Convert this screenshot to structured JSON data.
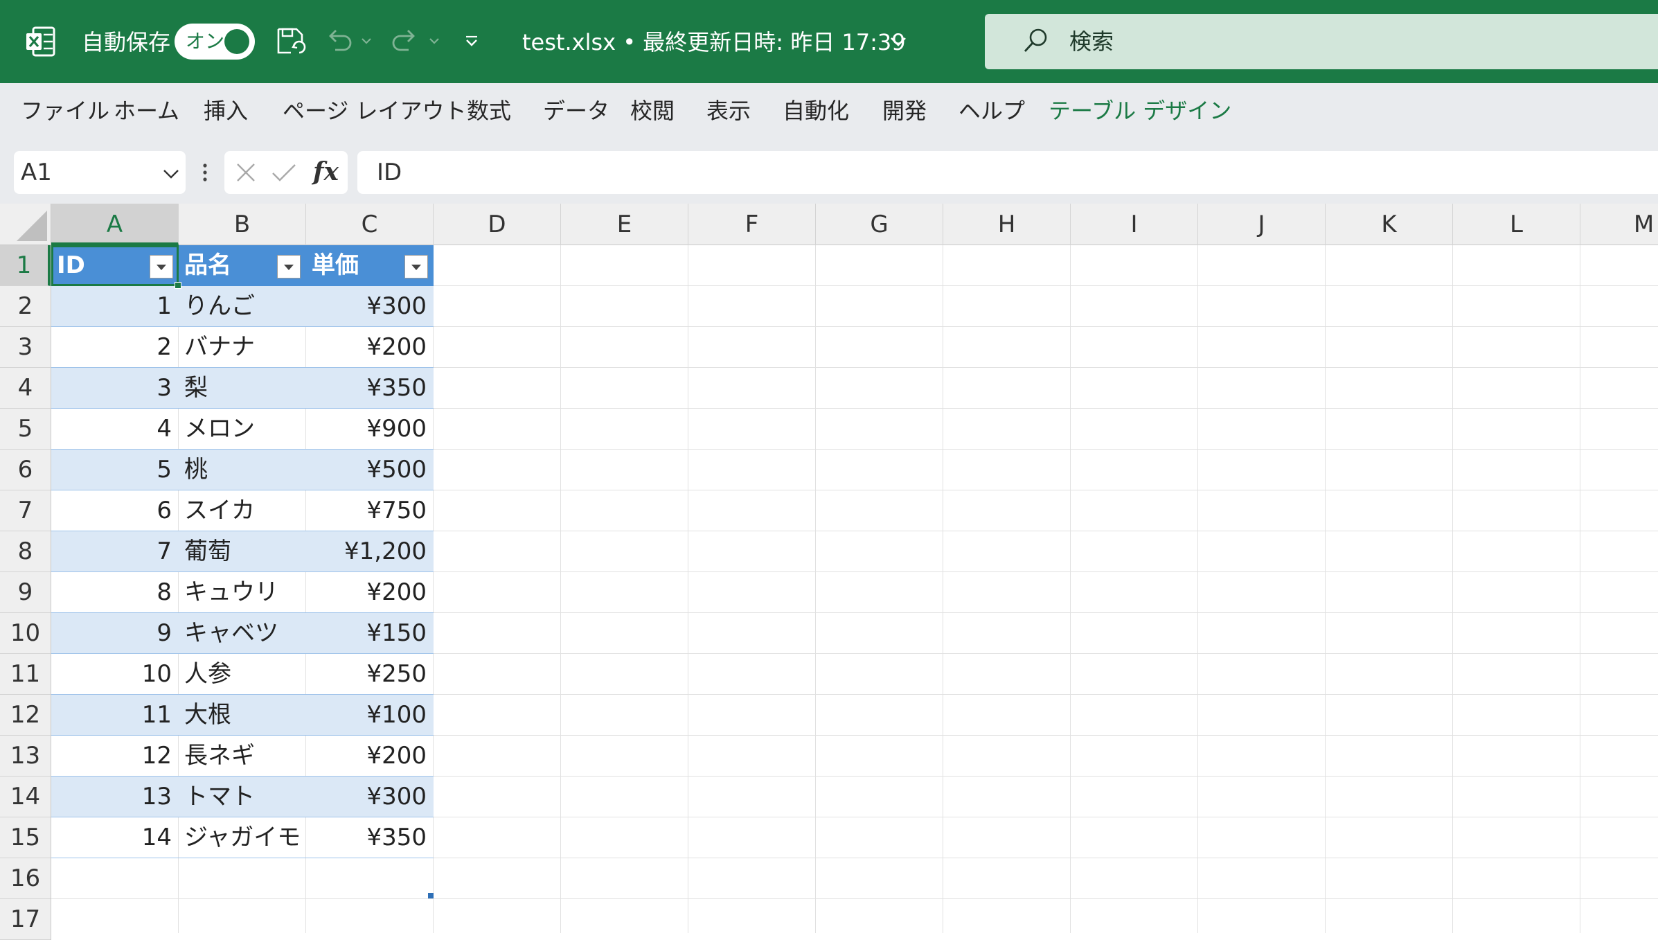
{
  "titlebar": {
    "app_icon": "excel-logo-icon",
    "autosave_label": "自動保存",
    "autosave_state": "オン",
    "doc_title": "test.xlsx • 最終更新日時: 昨日 17:39",
    "search_placeholder": "検索",
    "accent_color": "#1b7a45"
  },
  "ribbon": {
    "tabs": [
      "ファイル",
      "ホーム",
      "挿入",
      "ページ レイアウト",
      "数式",
      "データ",
      "校閲",
      "表示",
      "自動化",
      "開発",
      "ヘルプ",
      "テーブル デザイン"
    ],
    "active_tab": "テーブル デザイン"
  },
  "formula_bar": {
    "name_box": "A1",
    "fx_label": "fx",
    "content": "ID"
  },
  "sheet": {
    "columns": [
      "A",
      "B",
      "C",
      "D",
      "E",
      "F",
      "G",
      "H",
      "I",
      "J",
      "K",
      "L",
      "M"
    ],
    "rows": [
      "1",
      "2",
      "3",
      "4",
      "5",
      "6",
      "7",
      "8",
      "9",
      "10",
      "11",
      "12",
      "13",
      "14",
      "15",
      "16",
      "17"
    ],
    "selected_column": "A",
    "selected_row": "1",
    "table": {
      "headers": [
        "ID",
        "品名",
        "単価"
      ],
      "rows": [
        [
          "1",
          "りんご",
          "¥300"
        ],
        [
          "2",
          "バナナ",
          "¥200"
        ],
        [
          "3",
          "梨",
          "¥350"
        ],
        [
          "4",
          "メロン",
          "¥900"
        ],
        [
          "5",
          "桃",
          "¥500"
        ],
        [
          "6",
          "スイカ",
          "¥750"
        ],
        [
          "7",
          "葡萄",
          "¥1,200"
        ],
        [
          "8",
          "キュウリ",
          "¥200"
        ],
        [
          "9",
          "キャベツ",
          "¥150"
        ],
        [
          "10",
          "人参",
          "¥250"
        ],
        [
          "11",
          "大根",
          "¥100"
        ],
        [
          "12",
          "長ネギ",
          "¥200"
        ],
        [
          "13",
          "トマト",
          "¥300"
        ],
        [
          "14",
          "ジャガイモ",
          "¥350"
        ]
      ],
      "header_color": "#4a8fd6",
      "band_color": "#dbe8f6"
    }
  }
}
